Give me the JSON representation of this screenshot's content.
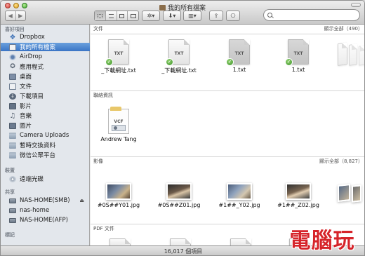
{
  "window": {
    "title": "我的所有檔案"
  },
  "toolbar": {
    "back_icon": "chevron-left-icon",
    "forward_icon": "chevron-right-icon",
    "view_modes": [
      "icon-view",
      "list-view",
      "column-view",
      "cover-flow-view"
    ],
    "action_label": "✲",
    "dropbox_label": "⬇",
    "arrange_label": "▥",
    "share_label": "⇪",
    "tags_label": "⎔",
    "search_placeholder": ""
  },
  "sidebar": {
    "favorites_header": "喜好項目",
    "favorites": [
      {
        "label": "Dropbox",
        "icon": "dropbox-icon"
      },
      {
        "label": "我的所有檔案",
        "icon": "all-files-icon",
        "selected": true
      },
      {
        "label": "AirDrop",
        "icon": "airdrop-icon"
      },
      {
        "label": "應用程式",
        "icon": "applications-icon"
      },
      {
        "label": "桌面",
        "icon": "desktop-icon"
      },
      {
        "label": "文件",
        "icon": "documents-icon"
      },
      {
        "label": "下載項目",
        "icon": "downloads-icon"
      },
      {
        "label": "影片",
        "icon": "movies-icon"
      },
      {
        "label": "音樂",
        "icon": "music-icon"
      },
      {
        "label": "圖片",
        "icon": "pictures-icon"
      },
      {
        "label": "Camera Uploads",
        "icon": "folder-icon"
      },
      {
        "label": "暫時交換資料",
        "icon": "folder-icon"
      },
      {
        "label": "微信公眾平台",
        "icon": "folder-icon"
      }
    ],
    "devices_header": "裝置",
    "devices": [
      {
        "label": "遠端光碟",
        "icon": "remote-disc-icon"
      }
    ],
    "shared_header": "共享",
    "shared": [
      {
        "label": "NAS-HOME(SMB)",
        "icon": "server-icon",
        "eject": "⏏"
      },
      {
        "label": "nas-home",
        "icon": "server-icon"
      },
      {
        "label": "NAS-HOME(AFP)",
        "icon": "server-icon"
      }
    ],
    "tags_header": "標記"
  },
  "sections": {
    "documents": {
      "title": "文件",
      "count": "顯示全部（490）",
      "items": [
        {
          "name": "_下載網址.txt",
          "ext": "TXT"
        },
        {
          "name": "_下載網址.txt",
          "ext": "TXT"
        },
        {
          "name": "1.txt",
          "ext": "TXT"
        },
        {
          "name": "1.txt",
          "ext": "TXT"
        }
      ]
    },
    "contacts": {
      "title": "聯絡資訊",
      "items": [
        {
          "name": "Andrew Tang",
          "ext": "VCF"
        }
      ]
    },
    "images": {
      "title": "影像",
      "count": "顯示全部（8,827）",
      "items": [
        {
          "name": "#0S##Y01.jpg"
        },
        {
          "name": "#0S##Z01.jpg"
        },
        {
          "name": "#1##_Y02.jpg"
        },
        {
          "name": "#1##_Z02.jpg"
        }
      ]
    },
    "pdf": {
      "title": "PDF 文件"
    }
  },
  "status": {
    "item_count": "16,017 個項目"
  },
  "watermark": "電腦玩"
}
